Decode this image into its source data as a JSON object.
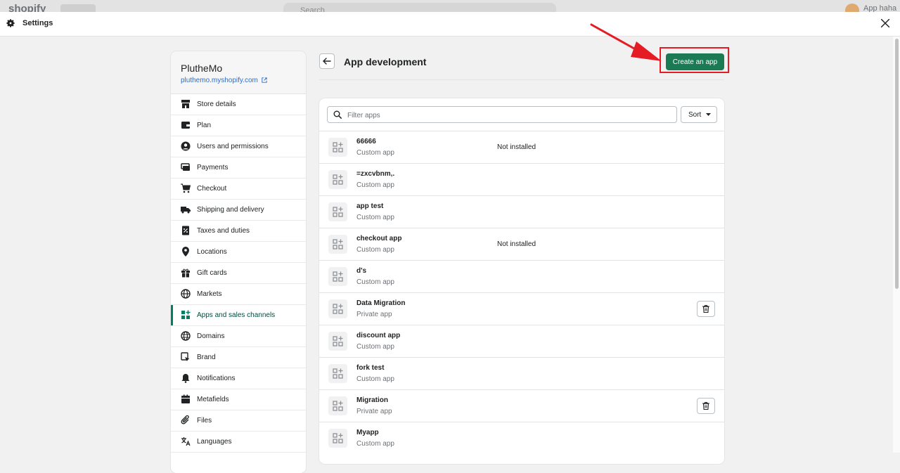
{
  "background": {
    "logo": "shopify",
    "search_placeholder": "Search",
    "user_name": "App haha"
  },
  "header": {
    "title": "Settings",
    "gear_icon": "gear-icon",
    "close_icon": "close-icon"
  },
  "store": {
    "name": "PlutheMo",
    "url": "pluthemo.myshopify.com"
  },
  "sidebar": {
    "items": [
      {
        "label": "Store details",
        "icon": "store-icon"
      },
      {
        "label": "Plan",
        "icon": "plan-icon"
      },
      {
        "label": "Users and permissions",
        "icon": "user-icon"
      },
      {
        "label": "Payments",
        "icon": "payments-icon"
      },
      {
        "label": "Checkout",
        "icon": "cart-icon"
      },
      {
        "label": "Shipping and delivery",
        "icon": "truck-icon"
      },
      {
        "label": "Taxes and duties",
        "icon": "tax-icon"
      },
      {
        "label": "Locations",
        "icon": "location-pin-icon"
      },
      {
        "label": "Gift cards",
        "icon": "gift-icon"
      },
      {
        "label": "Markets",
        "icon": "globe-icon"
      },
      {
        "label": "Apps and sales channels",
        "icon": "apps-icon",
        "active": true
      },
      {
        "label": "Domains",
        "icon": "domain-globe-icon"
      },
      {
        "label": "Brand",
        "icon": "brand-icon"
      },
      {
        "label": "Notifications",
        "icon": "bell-icon"
      },
      {
        "label": "Metafields",
        "icon": "metafields-icon"
      },
      {
        "label": "Files",
        "icon": "paperclip-icon"
      },
      {
        "label": "Languages",
        "icon": "translate-icon"
      }
    ]
  },
  "page": {
    "title": "App development",
    "create_button": "Create an app",
    "filter_placeholder": "Filter apps",
    "sort_label": "Sort",
    "highlight_color": "#e51c23",
    "accent_color": "#1a7a53"
  },
  "apps": [
    {
      "name": "66666",
      "type": "Custom app",
      "status": "Not installed",
      "delete": false
    },
    {
      "name": "=zxcvbnm,.",
      "type": "Custom app",
      "status": "",
      "delete": false
    },
    {
      "name": "app test",
      "type": "Custom app",
      "status": "",
      "delete": false
    },
    {
      "name": "checkout app",
      "type": "Custom app",
      "status": "Not installed",
      "delete": false
    },
    {
      "name": "d's",
      "type": "Custom app",
      "status": "",
      "delete": false
    },
    {
      "name": "Data Migration",
      "type": "Private app",
      "status": "",
      "delete": true
    },
    {
      "name": "discount app",
      "type": "Custom app",
      "status": "",
      "delete": false
    },
    {
      "name": "fork test",
      "type": "Custom app",
      "status": "",
      "delete": false
    },
    {
      "name": "Migration",
      "type": "Private app",
      "status": "",
      "delete": true
    },
    {
      "name": "Myapp",
      "type": "Custom app",
      "status": "",
      "delete": false
    }
  ]
}
